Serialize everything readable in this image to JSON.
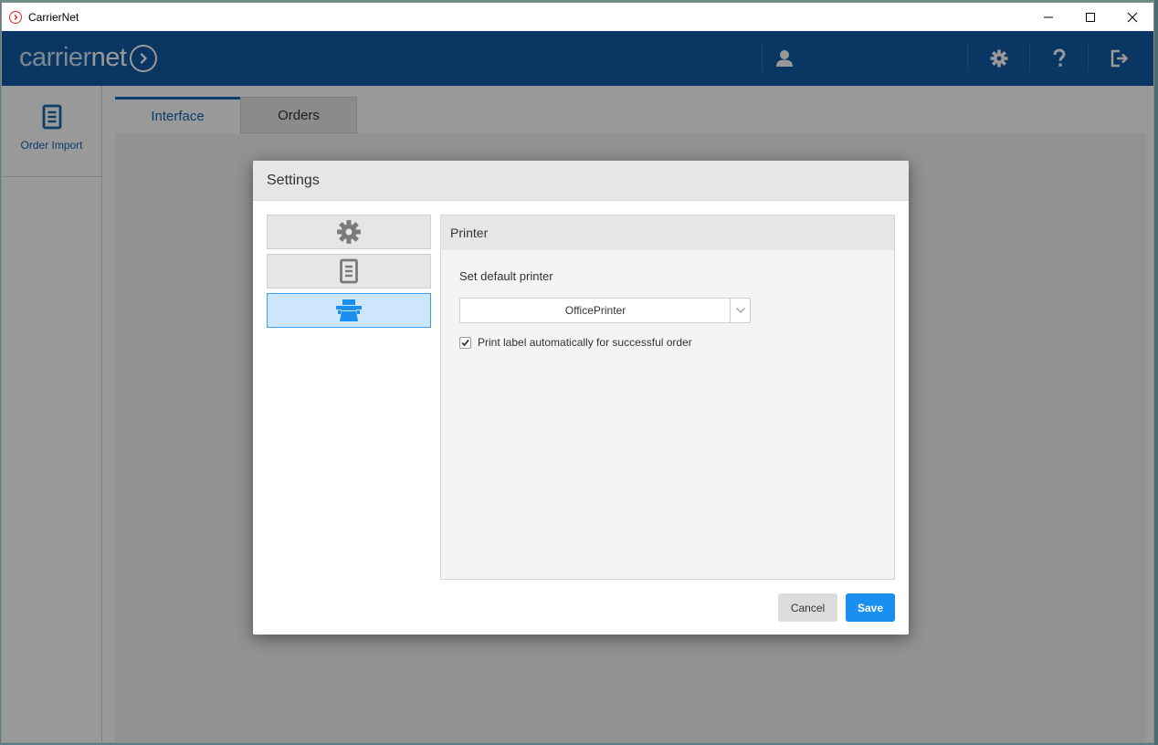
{
  "window": {
    "title": "CarrierNet",
    "controls": [
      "minimize-icon",
      "maximize-icon",
      "close-icon"
    ]
  },
  "appbar": {
    "logo_part1": "carrier",
    "logo_part2": "net",
    "icons": [
      "user-icon",
      "gear-icon",
      "help-icon",
      "logout-icon"
    ],
    "color": "#0f5aa3"
  },
  "sidebar": {
    "items": [
      {
        "label": "Order Import",
        "icon": "document-icon"
      }
    ]
  },
  "main": {
    "tabs": [
      {
        "label": "Interface",
        "active": true
      },
      {
        "label": "Orders",
        "active": false
      }
    ]
  },
  "dialog": {
    "title": "Settings",
    "categories": [
      {
        "icon": "gear-icon",
        "selected": false
      },
      {
        "icon": "document-icon",
        "selected": false
      },
      {
        "icon": "printer-icon",
        "selected": true
      }
    ],
    "panel": {
      "title": "Printer",
      "default_printer_label": "Set default printer",
      "printer_value": "OfficePrinter",
      "auto_print_label": "Print label automatically for successful order",
      "auto_print_checked": true
    },
    "buttons": {
      "cancel": "Cancel",
      "save": "Save"
    },
    "accent_color": "#1a8ff0"
  }
}
